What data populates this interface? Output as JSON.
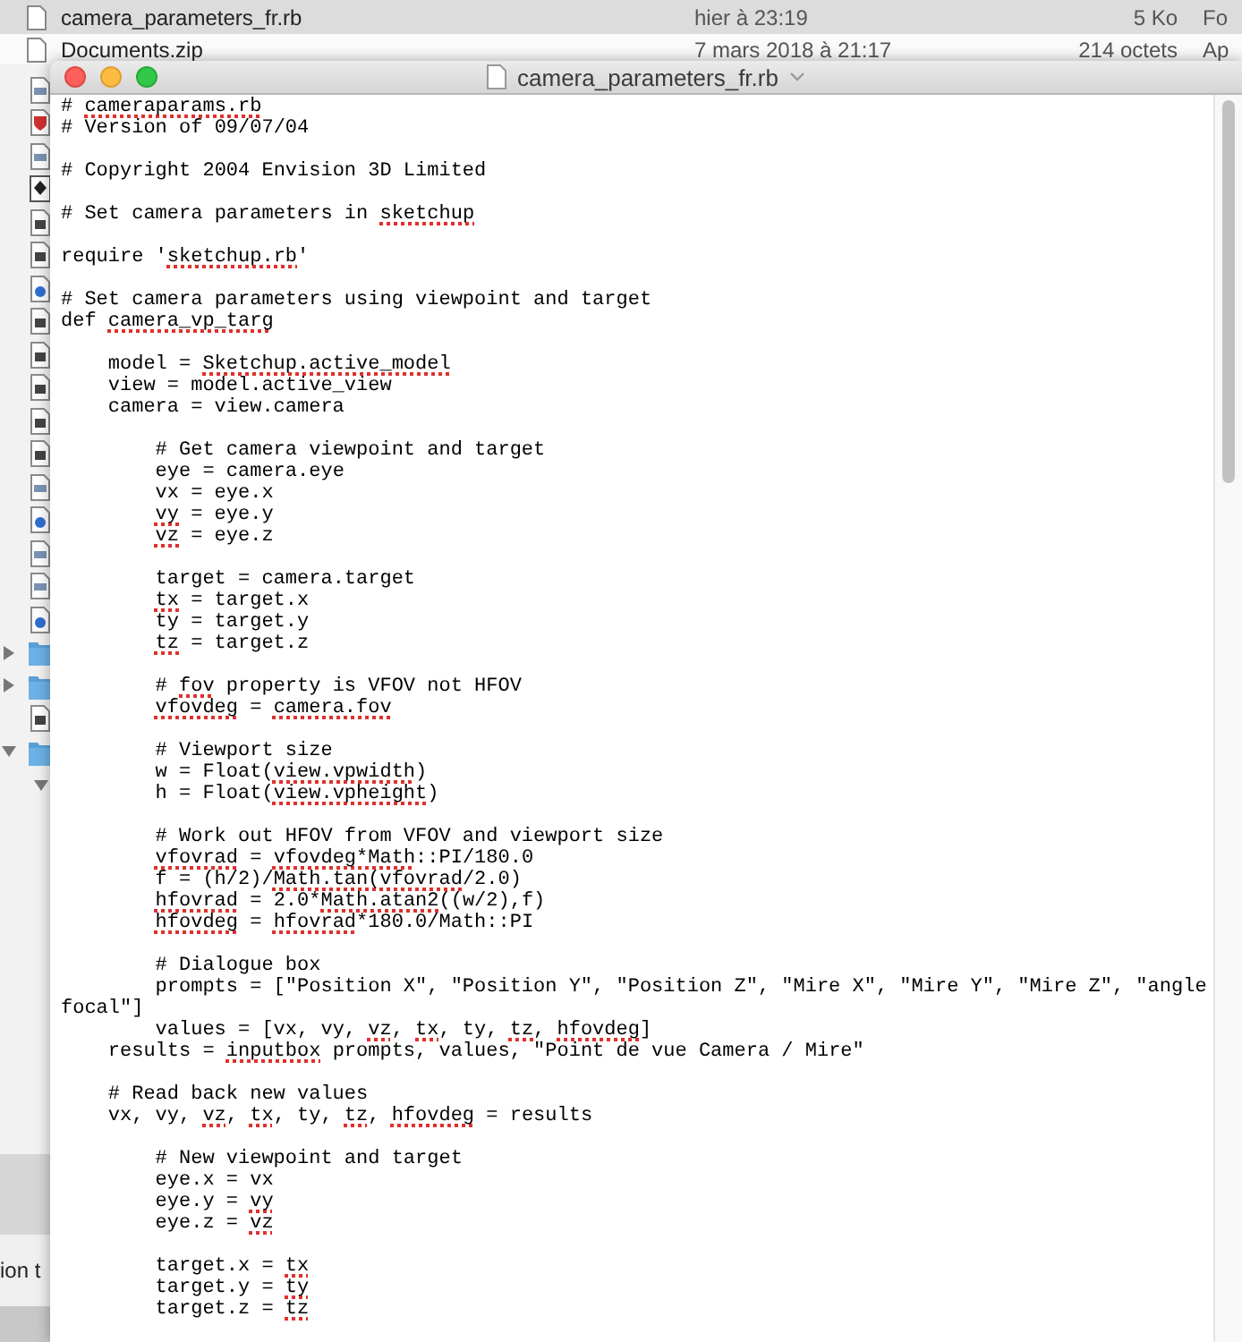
{
  "file_list": {
    "rows": [
      {
        "name": "camera_parameters_fr.rb",
        "date": "hier à 23:19",
        "size": "5 Ko",
        "column_4": "Fo",
        "selected": true
      },
      {
        "name": "Documents.zip",
        "date": "7 mars 2018 à 21:17",
        "size": "214 octets",
        "column_4": "Ap",
        "selected": false
      }
    ],
    "icon_column": [
      {
        "kind": "script"
      },
      {
        "kind": "shield"
      },
      {
        "kind": "script"
      },
      {
        "kind": "app"
      },
      {
        "kind": "text"
      },
      {
        "kind": "text"
      },
      {
        "kind": "web"
      },
      {
        "kind": "text"
      },
      {
        "kind": "text"
      },
      {
        "kind": "text"
      },
      {
        "kind": "text"
      },
      {
        "kind": "text"
      },
      {
        "kind": "script"
      },
      {
        "kind": "web"
      },
      {
        "kind": "script"
      },
      {
        "kind": "script"
      },
      {
        "kind": "web"
      },
      {
        "kind": "folder",
        "expanded": false
      },
      {
        "kind": "folder",
        "expanded": false
      },
      {
        "kind": "text"
      },
      {
        "kind": "folder",
        "expanded": true
      },
      {
        "kind": "disclosure",
        "expanded": true
      }
    ],
    "bottom_text": "ion t"
  },
  "window": {
    "title": "camera_parameters_fr.rb"
  },
  "editor": {
    "blocks": [
      {
        "lines": [
          {
            "kind": "flush",
            "segments": [
              {
                "text": "# ",
                "misspelled": false
              },
              {
                "text": "cameraparams.rb",
                "misspelled": true
              }
            ]
          },
          {
            "kind": "flush",
            "segments": [
              {
                "text": "# Version of 09/07/04",
                "misspelled": false
              }
            ]
          }
        ]
      },
      {
        "lines": [
          {
            "kind": "flush",
            "segments": [
              {
                "text": "# Copyright 2004 Envision 3D Limited",
                "misspelled": false
              }
            ]
          }
        ]
      },
      {
        "lines": [
          {
            "kind": "flush",
            "segments": [
              {
                "text": "# Set camera parameters in ",
                "misspelled": false
              },
              {
                "text": "sketchup",
                "misspelled": true
              }
            ]
          }
        ]
      },
      {
        "lines": [
          {
            "kind": "flush",
            "segments": [
              {
                "text": "require '",
                "misspelled": false
              },
              {
                "text": "sketchup.rb",
                "misspelled": true
              },
              {
                "text": "'",
                "misspelled": false
              }
            ]
          }
        ]
      },
      {
        "lines": [
          {
            "kind": "flush",
            "segments": [
              {
                "text": "# Set camera parameters using viewpoint and target",
                "misspelled": false
              }
            ]
          },
          {
            "kind": "flush",
            "segments": [
              {
                "text": "def ",
                "misspelled": false
              },
              {
                "text": "camera_vp_targ",
                "misspelled": true
              }
            ]
          }
        ]
      },
      {
        "lines": [
          {
            "kind": "indented",
            "segments": [
              {
                "text": "model = ",
                "misspelled": false
              },
              {
                "text": "Sketchup.active_model",
                "misspelled": true
              }
            ]
          },
          {
            "kind": "indented",
            "segments": [
              {
                "text": "view = model.active_view",
                "misspelled": false
              }
            ]
          },
          {
            "kind": "indented",
            "segments": [
              {
                "text": "camera = view.camera",
                "misspelled": false
              }
            ]
          }
        ]
      },
      {
        "lines": [
          {
            "kind": "nested",
            "segments": [
              {
                "text": "# Get camera viewpoint and target",
                "misspelled": false
              }
            ]
          },
          {
            "kind": "nested",
            "segments": [
              {
                "text": "eye = camera.eye",
                "misspelled": false
              }
            ]
          },
          {
            "kind": "nested",
            "segments": [
              {
                "text": "vx = eye.x",
                "misspelled": false
              }
            ]
          },
          {
            "kind": "nested",
            "segments": [
              {
                "text": "vy",
                "misspelled": true
              },
              {
                "text": " = eye.y",
                "misspelled": false
              }
            ]
          },
          {
            "kind": "nested",
            "segments": [
              {
                "text": "vz",
                "misspelled": true
              },
              {
                "text": " = eye.z",
                "misspelled": false
              }
            ]
          }
        ]
      },
      {
        "lines": [
          {
            "kind": "nested",
            "segments": [
              {
                "text": "target = camera.target",
                "misspelled": false
              }
            ]
          },
          {
            "kind": "nested",
            "segments": [
              {
                "text": "tx",
                "misspelled": true
              },
              {
                "text": " = target.x",
                "misspelled": false
              }
            ]
          },
          {
            "kind": "nested",
            "segments": [
              {
                "text": "ty = target.y",
                "misspelled": false
              }
            ]
          },
          {
            "kind": "nested",
            "segments": [
              {
                "text": "tz",
                "misspelled": true
              },
              {
                "text": " = target.z",
                "misspelled": false
              }
            ]
          }
        ]
      },
      {
        "lines": [
          {
            "kind": "nested",
            "segments": [
              {
                "text": "# ",
                "misspelled": false
              },
              {
                "text": "fov",
                "misspelled": true
              },
              {
                "text": " property is VFOV not HFOV",
                "misspelled": false
              }
            ]
          },
          {
            "kind": "nested",
            "segments": [
              {
                "text": "vfovdeg",
                "misspelled": true
              },
              {
                "text": " = ",
                "misspelled": false
              },
              {
                "text": "camera.fov",
                "misspelled": true
              }
            ]
          }
        ]
      },
      {
        "lines": [
          {
            "kind": "nested",
            "segments": [
              {
                "text": "# Viewport size",
                "misspelled": false
              }
            ]
          },
          {
            "kind": "nested",
            "segments": [
              {
                "text": "w = Float(",
                "misspelled": false
              },
              {
                "text": "view.vpwidth",
                "misspelled": true
              },
              {
                "text": ")",
                "misspelled": false
              }
            ]
          },
          {
            "kind": "nested",
            "segments": [
              {
                "text": "h = Float(",
                "misspelled": false
              },
              {
                "text": "view.vpheight",
                "misspelled": true
              },
              {
                "text": ")",
                "misspelled": false
              }
            ]
          }
        ]
      },
      {
        "lines": [
          {
            "kind": "nested",
            "segments": [
              {
                "text": "# Work out HFOV from VFOV and viewport size",
                "misspelled": false
              }
            ]
          },
          {
            "kind": "nested",
            "segments": [
              {
                "text": "vfovrad",
                "misspelled": true
              },
              {
                "text": " = ",
                "misspelled": false
              },
              {
                "text": "vfovdeg*Math",
                "misspelled": true
              },
              {
                "text": "::PI/180.0",
                "misspelled": false
              }
            ]
          },
          {
            "kind": "nested",
            "segments": [
              {
                "text": "f = (h/2)/",
                "misspelled": false
              },
              {
                "text": "Math.tan(vfovrad",
                "misspelled": true
              },
              {
                "text": "/2.0)",
                "misspelled": false
              }
            ]
          },
          {
            "kind": "nested",
            "segments": [
              {
                "text": "hfovrad",
                "misspelled": true
              },
              {
                "text": " = 2.0*",
                "misspelled": false
              },
              {
                "text": "Math.atan2",
                "misspelled": true
              },
              {
                "text": "((w/2),f)",
                "misspelled": false
              }
            ]
          },
          {
            "kind": "nested",
            "segments": [
              {
                "text": "hfovdeg",
                "misspelled": true
              },
              {
                "text": " = ",
                "misspelled": false
              },
              {
                "text": "hfovrad",
                "misspelled": true
              },
              {
                "text": "*180.0/Math::PI",
                "misspelled": false
              }
            ]
          }
        ]
      },
      {
        "lines": [
          {
            "kind": "nested",
            "segments": [
              {
                "text": "# Dialogue box",
                "misspelled": false
              }
            ]
          },
          {
            "kind": "nested",
            "segments": [
              {
                "text": "prompts = [\"Position X\", \"Position Y\", \"Position Z\", \"Mire X\", \"Mire Y\", \"Mire Z\", \"angle",
                "misspelled": false
              }
            ]
          },
          {
            "kind": "flush",
            "segments": [
              {
                "text": "focal\"]",
                "misspelled": false
              }
            ]
          },
          {
            "kind": "nested",
            "segments": [
              {
                "text": "values = [vx, vy, ",
                "misspelled": false
              },
              {
                "text": "vz",
                "misspelled": true
              },
              {
                "text": ", ",
                "misspelled": false
              },
              {
                "text": "tx",
                "misspelled": true
              },
              {
                "text": ", ty, ",
                "misspelled": false
              },
              {
                "text": "tz",
                "misspelled": true
              },
              {
                "text": ", ",
                "misspelled": false
              },
              {
                "text": "hfovdeg",
                "misspelled": true
              },
              {
                "text": "]",
                "misspelled": false
              }
            ]
          },
          {
            "kind": "indented",
            "segments": [
              {
                "text": "results = ",
                "misspelled": false
              },
              {
                "text": "inputbox",
                "misspelled": true
              },
              {
                "text": " prompts, values, \"Point de vue Camera / Mire\"",
                "misspelled": false
              }
            ]
          }
        ]
      },
      {
        "lines": [
          {
            "kind": "indented",
            "segments": [
              {
                "text": "# Read back new values",
                "misspelled": false
              }
            ]
          },
          {
            "kind": "indented",
            "segments": [
              {
                "text": "vx, vy, ",
                "misspelled": false
              },
              {
                "text": "vz",
                "misspelled": true
              },
              {
                "text": ", ",
                "misspelled": false
              },
              {
                "text": "tx",
                "misspelled": true
              },
              {
                "text": ", ty, ",
                "misspelled": false
              },
              {
                "text": "tz",
                "misspelled": true
              },
              {
                "text": ", ",
                "misspelled": false
              },
              {
                "text": "hfovdeg",
                "misspelled": true
              },
              {
                "text": " = results",
                "misspelled": false
              }
            ]
          }
        ]
      },
      {
        "lines": [
          {
            "kind": "nested",
            "segments": [
              {
                "text": "# New viewpoint and target",
                "misspelled": false
              }
            ]
          },
          {
            "kind": "nested",
            "segments": [
              {
                "text": "eye.x = vx",
                "misspelled": false
              }
            ]
          },
          {
            "kind": "nested",
            "segments": [
              {
                "text": "eye.y = ",
                "misspelled": false
              },
              {
                "text": "vy",
                "misspelled": true
              }
            ]
          },
          {
            "kind": "nested",
            "segments": [
              {
                "text": "eye.z = ",
                "misspelled": false
              },
              {
                "text": "vz",
                "misspelled": true
              }
            ]
          }
        ]
      },
      {
        "lines": [
          {
            "kind": "nested",
            "segments": [
              {
                "text": "target.x = ",
                "misspelled": false
              },
              {
                "text": "tx",
                "misspelled": true
              }
            ]
          },
          {
            "kind": "nested",
            "segments": [
              {
                "text": "target.y = ",
                "misspelled": false
              },
              {
                "text": "ty",
                "misspelled": true
              }
            ]
          },
          {
            "kind": "nested",
            "segments": [
              {
                "text": "target.z = ",
                "misspelled": false
              },
              {
                "text": "tz",
                "misspelled": true
              }
            ]
          }
        ]
      }
    ]
  }
}
